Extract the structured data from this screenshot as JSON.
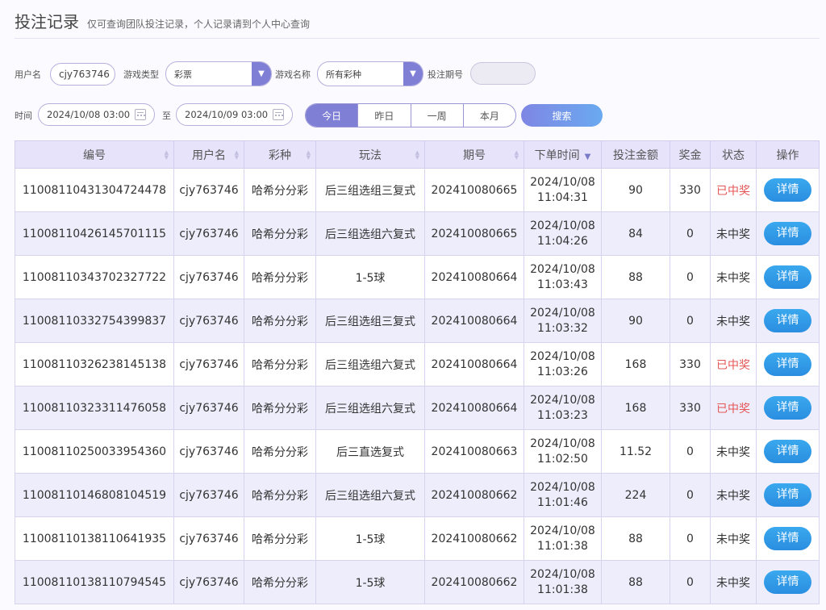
{
  "header": {
    "title": "投注记录",
    "subtitle": "仅可查询团队投注记录，个人记录请到个人中心查询"
  },
  "filters": {
    "username_label": "用户名",
    "username_value": "cjy763746",
    "game_type_label": "游戏类型",
    "game_type_value": "彩票",
    "game_name_label": "游戏名称",
    "game_name_value": "所有彩种",
    "issue_label": "投注期号",
    "issue_value": "",
    "time_label": "时间",
    "start_time": "2024/10/08 03:00",
    "to_label": "至",
    "end_time": "2024/10/09 03:00",
    "ranges": [
      "今日",
      "昨日",
      "一周",
      "本月"
    ],
    "active_range": "今日",
    "search_label": "搜索"
  },
  "table": {
    "columns": [
      "编号",
      "用户名",
      "彩种",
      "玩法",
      "期号",
      "下单时间",
      "投注金额",
      "奖金",
      "状态",
      "操作"
    ],
    "detail_label": "详情",
    "rows": [
      {
        "id": "1100811043130472447​8",
        "user": "cjy763746",
        "lottery": "哈希分分彩",
        "play": "后三组选组三复式",
        "issue": "202410080665",
        "date": "2024/10/08",
        "time": "11:04:31",
        "amount": "90",
        "prize": "330",
        "status": "已中奖",
        "won": true
      },
      {
        "id": "11008110426145701115",
        "user": "cjy763746",
        "lottery": "哈希分分彩",
        "play": "后三组选组六复式",
        "issue": "202410080665",
        "date": "2024/10/08",
        "time": "11:04:26",
        "amount": "84",
        "prize": "0",
        "status": "未中奖",
        "won": false
      },
      {
        "id": "11008110343702327722",
        "user": "cjy763746",
        "lottery": "哈希分分彩",
        "play": "1-5球",
        "issue": "202410080664",
        "date": "2024/10/08",
        "time": "11:03:43",
        "amount": "88",
        "prize": "0",
        "status": "未中奖",
        "won": false
      },
      {
        "id": "11008110332754399837",
        "user": "cjy763746",
        "lottery": "哈希分分彩",
        "play": "后三组选组三复式",
        "issue": "202410080664",
        "date": "2024/10/08",
        "time": "11:03:32",
        "amount": "90",
        "prize": "0",
        "status": "未中奖",
        "won": false
      },
      {
        "id": "11008110326238145138",
        "user": "cjy763746",
        "lottery": "哈希分分彩",
        "play": "后三组选组六复式",
        "issue": "202410080664",
        "date": "2024/10/08",
        "time": "11:03:26",
        "amount": "168",
        "prize": "330",
        "status": "已中奖",
        "won": true
      },
      {
        "id": "11008110323311476058",
        "user": "cjy763746",
        "lottery": "哈希分分彩",
        "play": "后三组选组六复式",
        "issue": "202410080664",
        "date": "2024/10/08",
        "time": "11:03:23",
        "amount": "168",
        "prize": "330",
        "status": "已中奖",
        "won": true
      },
      {
        "id": "11008110250033954360",
        "user": "cjy763746",
        "lottery": "哈希分分彩",
        "play": "后三直选复式",
        "issue": "202410080663",
        "date": "2024/10/08",
        "time": "11:02:50",
        "amount": "11.52",
        "prize": "0",
        "status": "未中奖",
        "won": false
      },
      {
        "id": "11008110146808104519",
        "user": "cjy763746",
        "lottery": "哈希分分彩",
        "play": "后三组选组六复式",
        "issue": "202410080662",
        "date": "2024/10/08",
        "time": "11:01:46",
        "amount": "224",
        "prize": "0",
        "status": "未中奖",
        "won": false
      },
      {
        "id": "11008110138110641935",
        "user": "cjy763746",
        "lottery": "哈希分分彩",
        "play": "1-5球",
        "issue": "202410080662",
        "date": "2024/10/08",
        "time": "11:01:38",
        "amount": "88",
        "prize": "0",
        "status": "未中奖",
        "won": false
      },
      {
        "id": "11008110138110794545",
        "user": "cjy763746",
        "lottery": "哈希分分彩",
        "play": "1-5球",
        "issue": "202410080662",
        "date": "2024/10/08",
        "time": "11:01:38",
        "amount": "88",
        "prize": "0",
        "status": "未中奖",
        "won": false
      }
    ]
  },
  "colors": {
    "accent": "#7f7fd6",
    "win_text": "#e55555",
    "detail_button": "#2a8ee0",
    "header_bg": "#e6e3fa"
  }
}
